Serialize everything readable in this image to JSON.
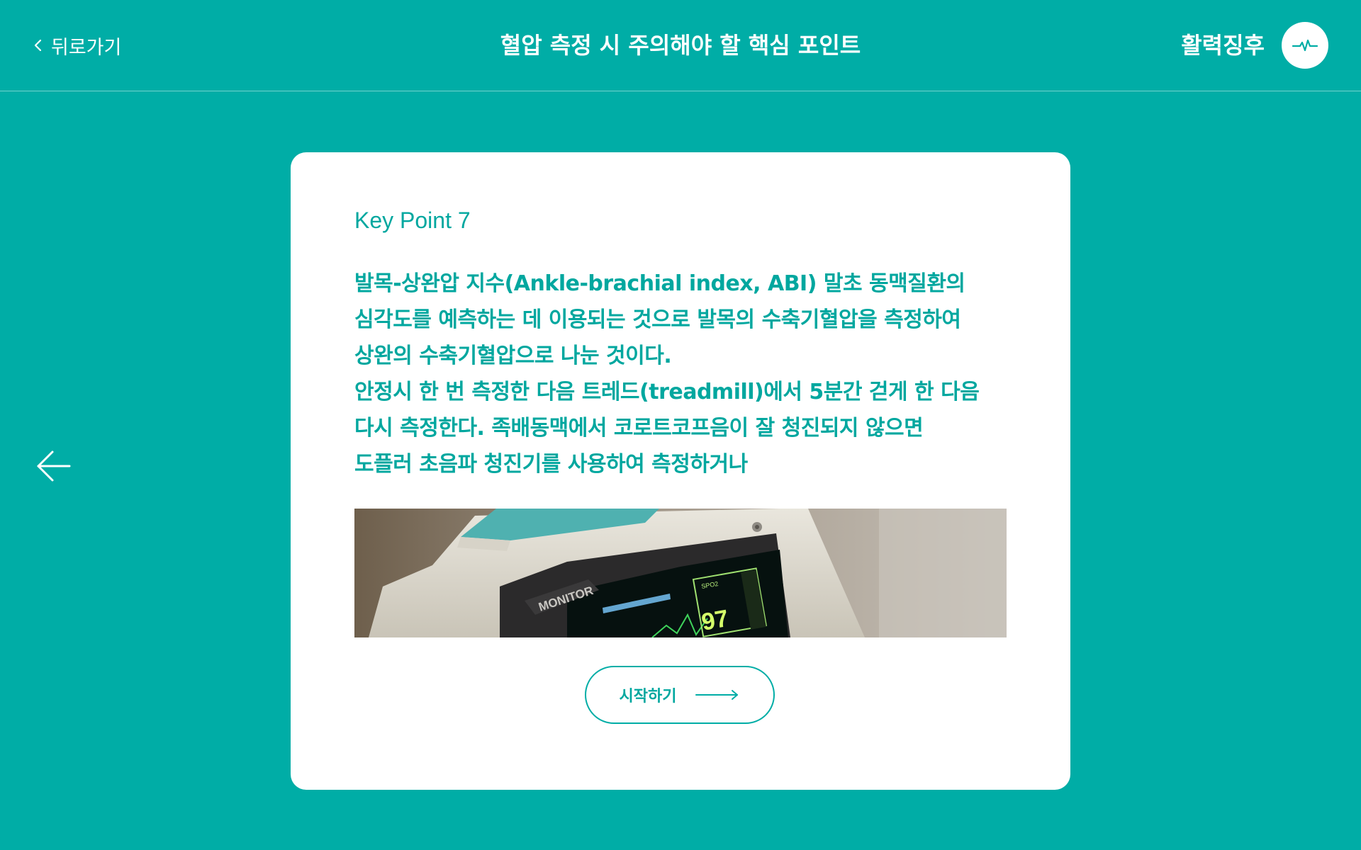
{
  "header": {
    "back_label": "뒤로가기",
    "title": "혈압 측정 시 주의해야 할 핵심 포인트",
    "section_label": "활력징후"
  },
  "card": {
    "key_point": "Key Point 7",
    "body": "발목-상완압 지수(Ankle-brachial index, ABI)  말초 동맥질환의\n심각도를 예측하는 데 이용되는 것으로 발목의 수축기혈압을 측정하여\n상완의 수축기혈압으로 나눈 것이다.\n안정시 한 번 측정한 다음 트레드(treadmill)에서 5분간 걷게 한 다음\n다시 측정한다.  족배동맥에서 코로트코프음이 잘 청진되지 않으면\n도플러 초음파 청진기를 사용하여 측정하거나",
    "image": {
      "monitor_brand": "MONITOR",
      "spo2_label": "SPO2",
      "spo2_value": "97"
    },
    "start_label": "시작하기"
  },
  "colors": {
    "primary": "#00ada6",
    "text_accent": "#00a79f",
    "card_bg": "#ffffff"
  },
  "icons": {
    "back": "chevron-left-icon",
    "vital": "pulse-icon",
    "prev": "arrow-left-icon",
    "start": "arrow-right-icon"
  }
}
